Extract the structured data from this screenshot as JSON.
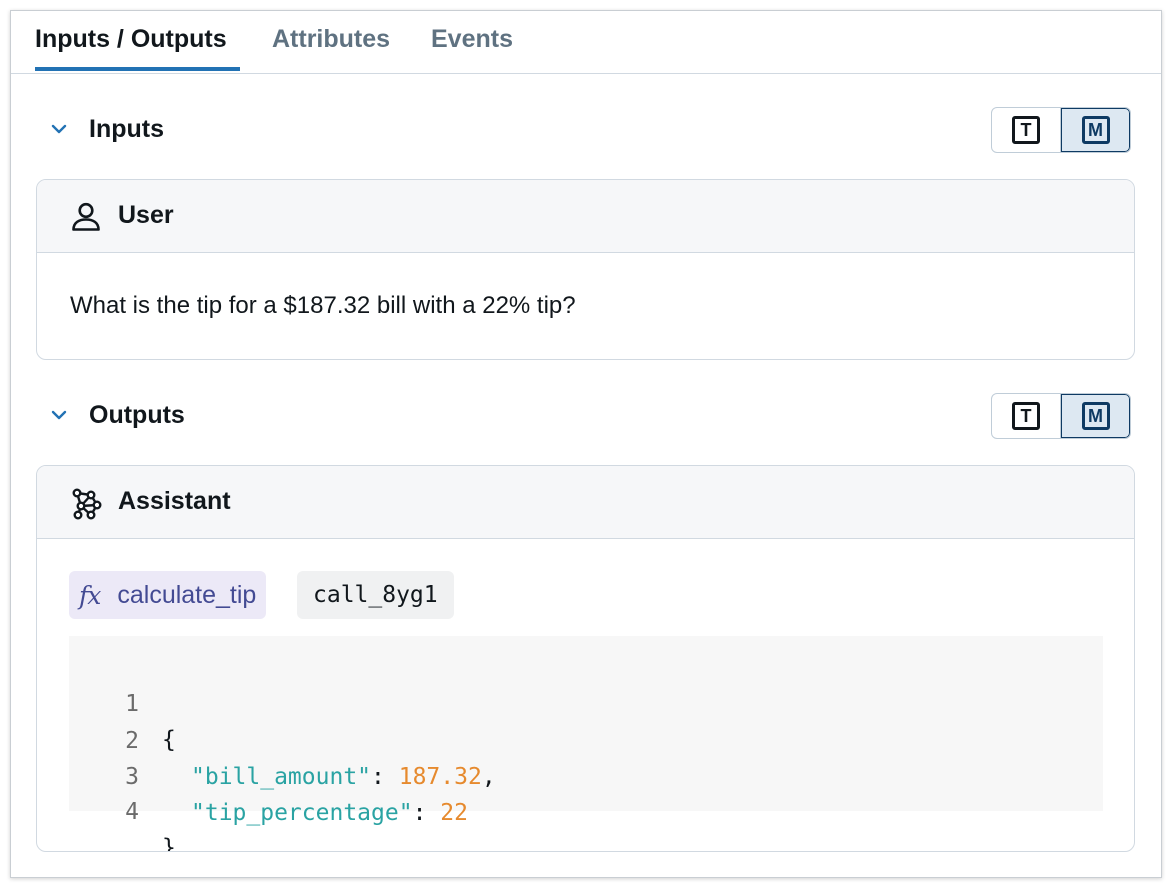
{
  "tabs": [
    {
      "label": "Inputs / Outputs",
      "active": true
    },
    {
      "label": "Attributes",
      "active": false
    },
    {
      "label": "Events",
      "active": false
    }
  ],
  "inputs": {
    "title": "Inputs",
    "toggle": {
      "text_glyph": "T",
      "markdown_glyph": "M",
      "selected": "M"
    },
    "message": {
      "role": "User",
      "role_icon": "user-icon",
      "text": "What is the tip for a $187.32 bill with a 22% tip?"
    }
  },
  "outputs": {
    "title": "Outputs",
    "toggle": {
      "text_glyph": "T",
      "markdown_glyph": "M",
      "selected": "M"
    },
    "message": {
      "role": "Assistant",
      "role_icon": "assistant-icon",
      "tool_call": {
        "fn_icon": "fx",
        "function_name": "calculate_tip",
        "call_id": "call_8yg1"
      },
      "code": {
        "line_numbers": [
          "1",
          "2",
          "3",
          "4"
        ],
        "open_brace": "{",
        "close_brace": "}",
        "key1": "\"bill_amount\"",
        "val1": "187.32",
        "key2": "\"tip_percentage\"",
        "val2": "22"
      }
    }
  },
  "colors": {
    "accent": "#2272b4",
    "function_badge_bg": "#ece9f7",
    "function_text": "#434a93",
    "json_key": "#2aa3a3",
    "json_number": "#e68a2e"
  }
}
